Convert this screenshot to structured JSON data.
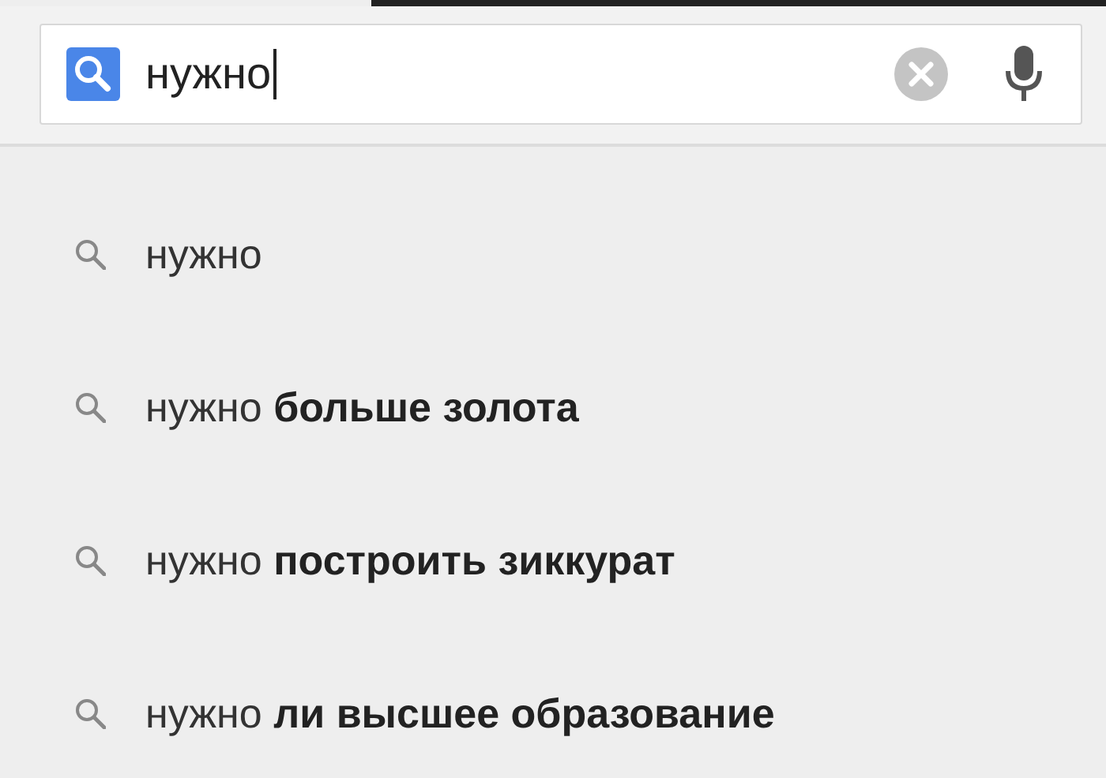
{
  "search": {
    "value": "нужно"
  },
  "suggestions": [
    {
      "text": "нужно"
    },
    {
      "text": "нужно **больше золота**"
    },
    {
      "text": "нужно **построить зиккурат**"
    },
    {
      "text": "нужно **ли высшее образование**"
    }
  ]
}
